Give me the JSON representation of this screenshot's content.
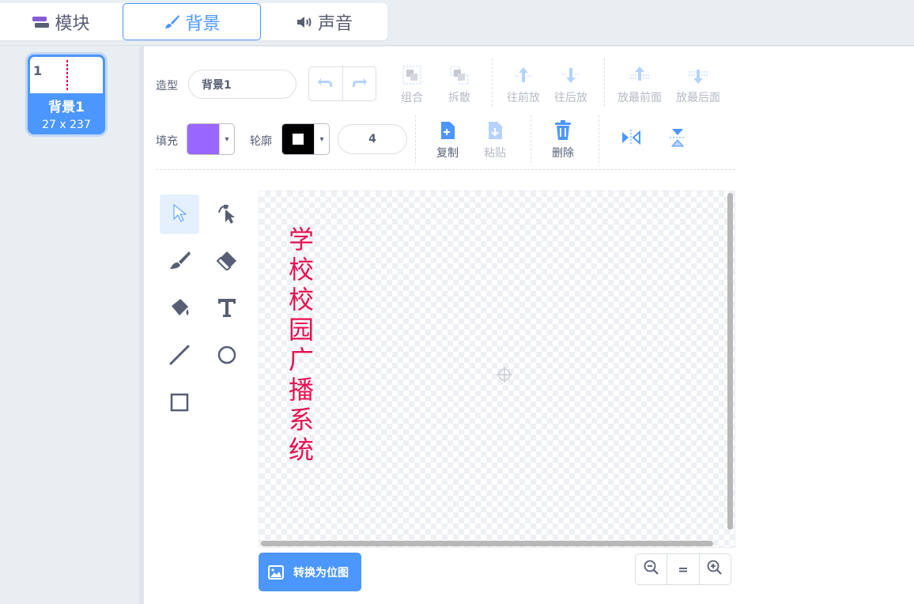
{
  "tabs": [
    {
      "label": "模块",
      "icon": "blocks-icon"
    },
    {
      "label": "背景",
      "icon": "paintbrush-icon",
      "active": true
    },
    {
      "label": "声音",
      "icon": "speaker-icon"
    }
  ],
  "costumes": [
    {
      "number": "1",
      "name": "背景1",
      "size": "27 x 237"
    }
  ],
  "toolbar": {
    "costume_label": "造型",
    "costume_name": "背景1",
    "group": "组合",
    "ungroup": "拆散",
    "forward": "往前放",
    "backward": "往后放",
    "front": "放最前面",
    "back": "放最后面",
    "fill_label": "填充",
    "fill_color": "#9966ff",
    "outline_label": "轮廓",
    "outline_color": "#000000",
    "outline_width": "4",
    "copy": "复制",
    "paste": "粘贴",
    "delete": "删除"
  },
  "tools": [
    "select-tool",
    "reshape-tool",
    "brush-tool",
    "eraser-tool",
    "fill-tool",
    "text-tool",
    "line-tool",
    "circle-tool",
    "rectangle-tool"
  ],
  "canvas": {
    "text": "学校校园广播系统",
    "text_color": "#e6104f"
  },
  "convert_button": "转换为位图",
  "zoom": {
    "out": "zoom-out-icon",
    "reset": "=",
    "in": "zoom-in-icon"
  },
  "colors": {
    "accent": "#4c97ff",
    "text": "#575e75",
    "disabled": "#b5bac4"
  }
}
